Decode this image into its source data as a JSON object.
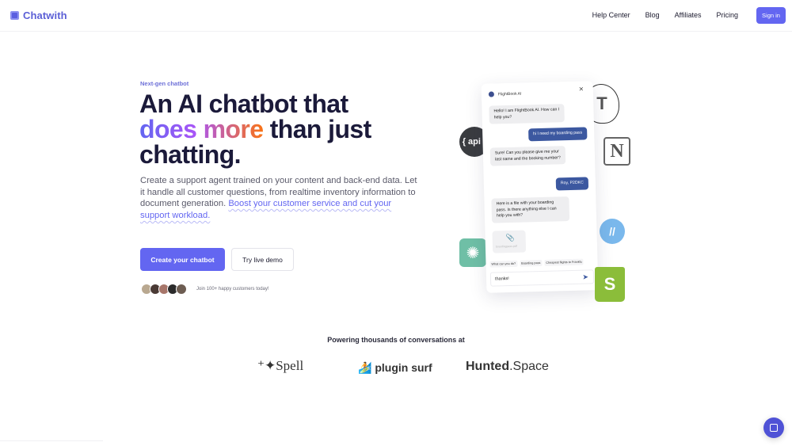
{
  "nav": {
    "brand": "Chatwith",
    "links": [
      "Help Center",
      "Blog",
      "Affiliates",
      "Pricing"
    ],
    "signin_label": "Sign in"
  },
  "hero": {
    "eyebrow": "Next-gen chatbot",
    "headline_line1": "An AI chatbot that",
    "headline_grad": "does more",
    "headline_line2_rest": " than just",
    "headline_line3": "chatting.",
    "description": "Create a support agent trained on your content and back-end data. Let it handle all customer questions, from realtime inventory information to document generation. ",
    "description_highlight": "Boost your customer service and cut your support workload.",
    "cta_primary": "Create your chatbot",
    "cta_secondary": "Try live demo",
    "social_proof": "Join 100+ happy customers today!",
    "avatar_colors": [
      "#b9a890",
      "#4a3a35",
      "#a7766a",
      "#2b2b2b",
      "#6d5d52"
    ]
  },
  "chat": {
    "bot_name": "FlightBook AI",
    "close_icon": "×",
    "messages": [
      {
        "from": "bot",
        "text": "Hello! I am FlightBook AI. How can I help you?"
      },
      {
        "from": "user",
        "text": "hi I need my boarding pass"
      },
      {
        "from": "bot",
        "text": "Sure! Can you please give me your last name and the booking number?"
      },
      {
        "from": "user",
        "text": "Roy, P2DKC"
      },
      {
        "from": "bot",
        "text": "Here is a file with your boarding pass. Is there anything else I can help you with?"
      }
    ],
    "attachment_name": "boardingpass.pdf",
    "chips": [
      "What can you do?",
      "Boarding pass",
      "Cheapest flights to Frankfu"
    ],
    "input_value": "thanks!"
  },
  "floating": {
    "api_label": "{ api }",
    "t_label": "T",
    "notion_label": "N",
    "helpscout_label": "//",
    "openai_label": "✺",
    "shopify_label": "S"
  },
  "partners": {
    "title": "Powering thousands of conversations at",
    "spell": "⁺✦Spell",
    "plugin": "plugin surf",
    "hunted_bold": "Hunted",
    "hunted_rest": ".Space"
  }
}
